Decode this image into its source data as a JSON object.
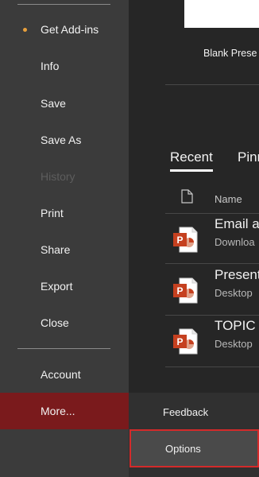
{
  "sidebar": {
    "items": [
      {
        "label": "Get Add-ins",
        "has_dot": true
      },
      {
        "label": "Info"
      },
      {
        "label": "Save"
      },
      {
        "label": "Save As"
      },
      {
        "label": "History",
        "disabled": true
      },
      {
        "label": "Print"
      },
      {
        "label": "Share"
      },
      {
        "label": "Export"
      },
      {
        "label": "Close"
      },
      {
        "label": "Account"
      },
      {
        "label": "More..."
      }
    ]
  },
  "templates": {
    "blank_label": "Blank Prese"
  },
  "tabs": [
    {
      "label": "Recent",
      "active": true
    },
    {
      "label": "Pinn"
    }
  ],
  "file_list": {
    "name_header": "Name",
    "rows": [
      {
        "name": "Email a",
        "location": "Downloa",
        "icon": "powerpoint-icon"
      },
      {
        "name": "Present",
        "location": "Desktop",
        "icon": "powerpoint-icon"
      },
      {
        "name": "TOPIC –",
        "location": "Desktop",
        "icon": "powerpoint-icon"
      }
    ]
  },
  "flyout": {
    "items": [
      {
        "label": "Feedback"
      },
      {
        "label": "Options",
        "highlighted": true
      }
    ]
  },
  "colors": {
    "sidebar_bg": "#3b3b3b",
    "content_bg": "#262626",
    "more_active_bg": "#7a1a1c",
    "highlight_border": "#d42a2a",
    "dot": "#e8a03c",
    "powerpoint_orange": "#c5401f"
  }
}
